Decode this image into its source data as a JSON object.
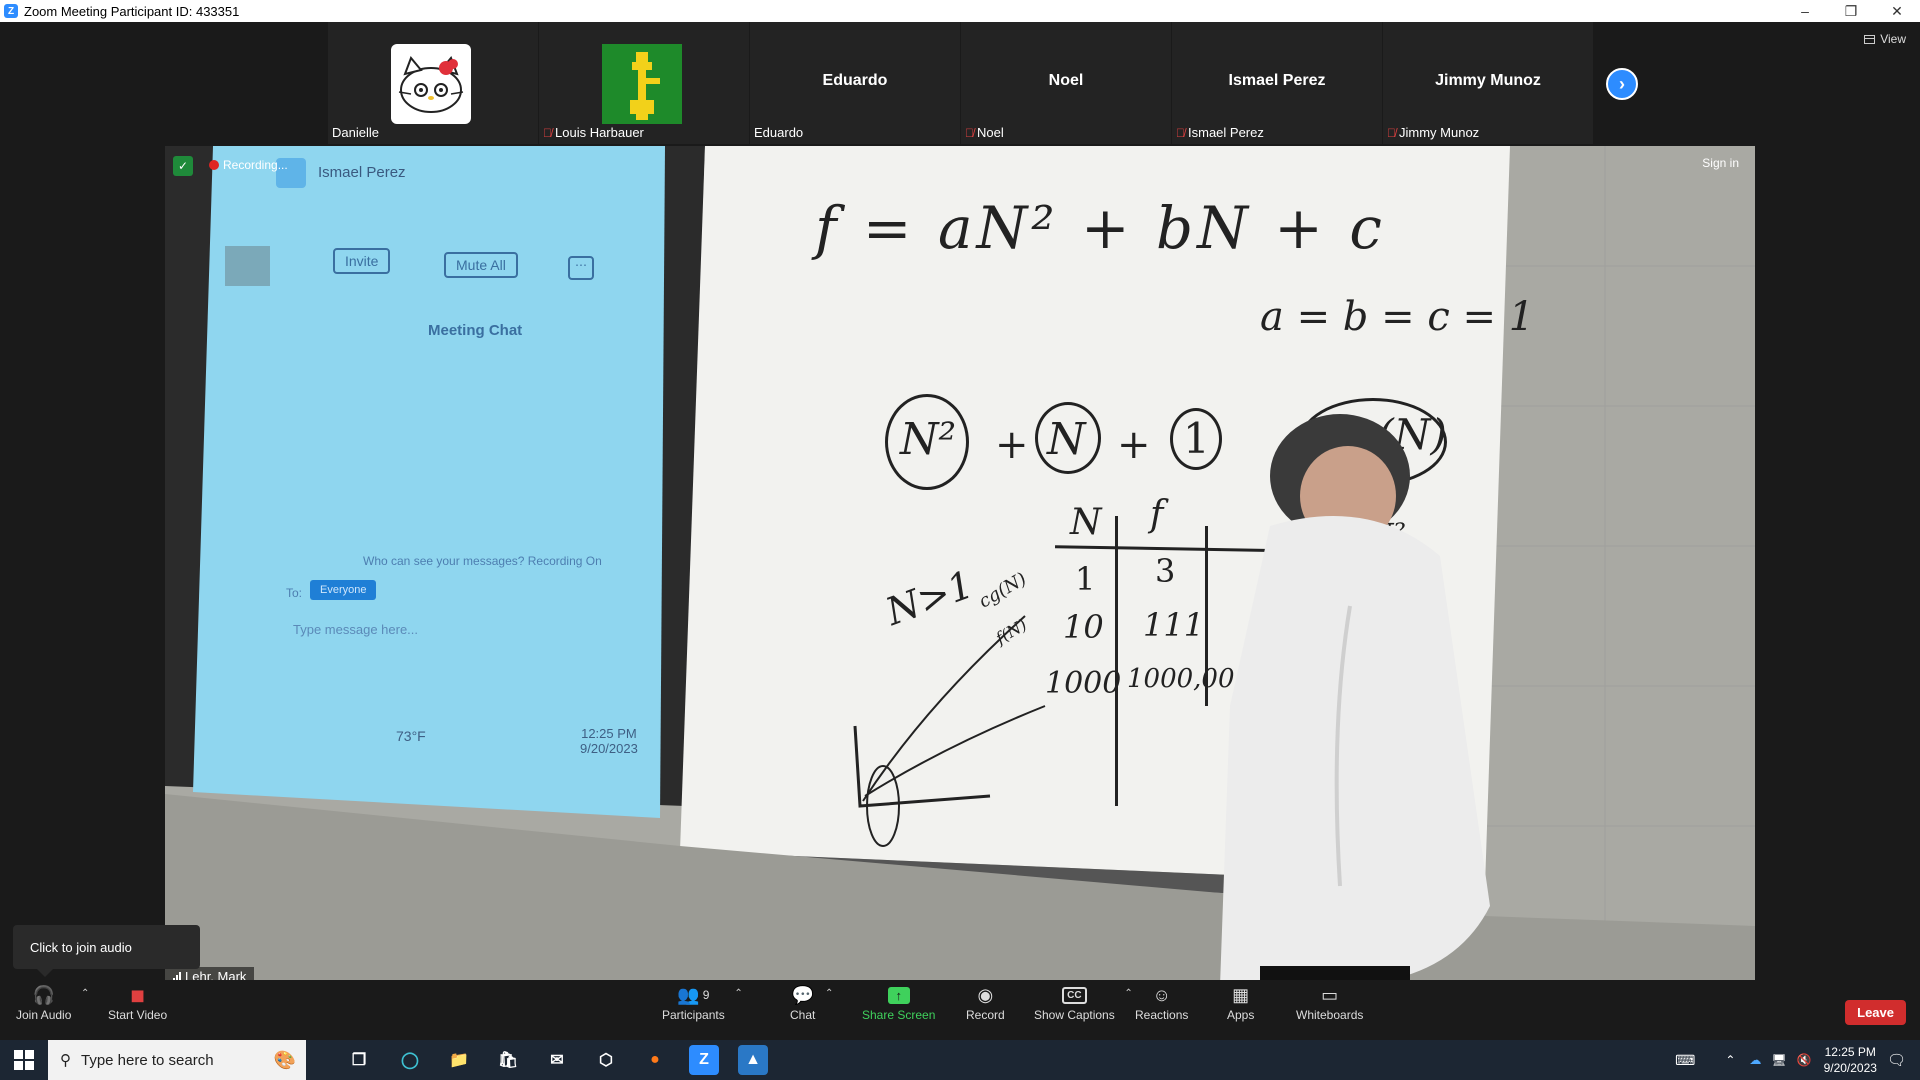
{
  "titlebar": {
    "title": "Zoom Meeting Participant ID: 433351"
  },
  "view_button": "View",
  "participants_strip": [
    {
      "name": "Danielle",
      "center_name": "",
      "muted": false,
      "avatar": "hello-kitty"
    },
    {
      "name": "Louis Harbauer",
      "center_name": "",
      "muted": true,
      "avatar": "green-pixel-figure"
    },
    {
      "name": "Eduardo",
      "center_name": "Eduardo",
      "muted": false,
      "avatar": ""
    },
    {
      "name": "Noel",
      "center_name": "Noel",
      "muted": true,
      "avatar": ""
    },
    {
      "name": "Ismael Perez",
      "center_name": "Ismael Perez",
      "muted": true,
      "avatar": ""
    },
    {
      "name": "Jimmy Munoz",
      "center_name": "Jimmy Munoz",
      "muted": true,
      "avatar": ""
    }
  ],
  "video": {
    "recording_label": "Recording...",
    "sign_in": "Sign in",
    "speaker_name": "Lehr, Mark",
    "projected_screen": {
      "participant": "Ismael Perez",
      "invite": "Invite",
      "mute_all": "Mute All",
      "chat_title": "Meeting Chat",
      "notice": "Who can see your messages? Recording On",
      "to_label": "To:",
      "to_value": "Everyone",
      "input_placeholder": "Type message here...",
      "weather": "73°F",
      "time": "12:25 PM",
      "date": "9/20/2023"
    },
    "whiteboard": {
      "equation": "f = aN² + bN + c",
      "constants": "a = b = c = 1",
      "bigO_left": "N²",
      "bigO_mid": "N",
      "bigO_one": "1",
      "bigO_right": "C g(N)",
      "table_headers": [
        "N",
        "f"
      ],
      "table_rows": [
        [
          "1",
          "3"
        ],
        [
          "10",
          "111"
        ],
        [
          "1000",
          "1000,001"
        ]
      ],
      "side_note": "2N²",
      "condition": "N>1",
      "g_note": "cg(N)",
      "f_note": "f(N)"
    }
  },
  "join_audio_tooltip": "Click to join audio",
  "toolbar": {
    "join_audio": "Join Audio",
    "start_video": "Start Video",
    "participants": "Participants",
    "participants_count": "9",
    "chat": "Chat",
    "share_screen": "Share Screen",
    "record": "Record",
    "show_captions": "Show Captions",
    "reactions": "Reactions",
    "apps": "Apps",
    "whiteboards": "Whiteboards",
    "leave": "Leave"
  },
  "taskbar": {
    "search_placeholder": "Type here to search",
    "time": "12:25 PM",
    "date": "9/20/2023"
  },
  "colors": {
    "zoom_blue": "#2d8cff",
    "share_green": "#3fd15c",
    "leave_red": "#d12d2d",
    "taskbar": "#1c2633"
  }
}
